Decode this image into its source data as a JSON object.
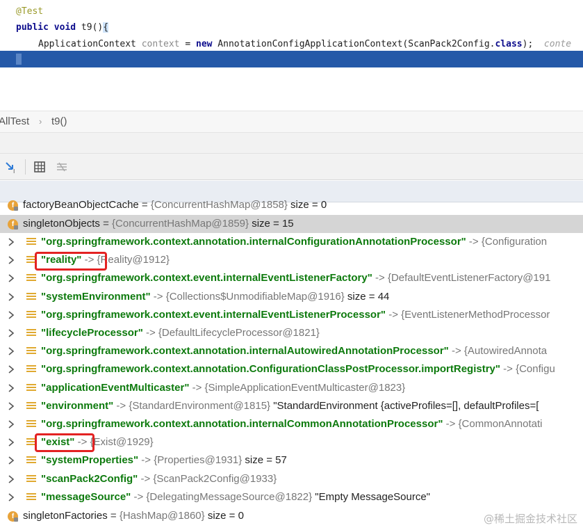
{
  "editor": {
    "annotation": "@Test",
    "sig_public": "public",
    "sig_void": "void",
    "sig_rest": " t9()",
    "sig_brace": "{",
    "stmt_type": "ApplicationContext ",
    "stmt_var": "context",
    "stmt_eq": " = ",
    "stmt_new": "new",
    "stmt_ctor": " AnnotationConfigApplicationContext(ScanPack2Config.",
    "stmt_class": "class",
    "stmt_end": ");",
    "stmt_hint": "  conte"
  },
  "breadcrumb": {
    "class_name": "AllTest",
    "separator": "›",
    "method_name": "t9()"
  },
  "toolbar": {
    "icons": [
      "step-into-icon",
      "table-view-icon",
      "evaluate-icon"
    ]
  },
  "tree": {
    "partial_field": {
      "name": "factoryBeanObjectCache",
      "eq": " = ",
      "value": "{ConcurrentHashMap@1858}",
      "size": "  size = 0"
    },
    "selected_field": {
      "name": "singletonObjects",
      "eq": " = ",
      "value": "{ConcurrentHashMap@1859}",
      "size": "  size = 15"
    },
    "entries": [
      {
        "key": "\"org.springframework.context.annotation.internalConfigurationAnnotationProcessor\"",
        "arrow": " -> ",
        "value": "{Configuration",
        "extra": ""
      },
      {
        "key": "\"reality\"",
        "arrow": " -> ",
        "value": "{Reality@1912}",
        "extra": ""
      },
      {
        "key": "\"org.springframework.context.event.internalEventListenerFactory\"",
        "arrow": " -> ",
        "value": "{DefaultEventListenerFactory@191",
        "extra": ""
      },
      {
        "key": "\"systemEnvironment\"",
        "arrow": " -> ",
        "value": "{Collections$UnmodifiableMap@1916}",
        "extra": "  size = 44"
      },
      {
        "key": "\"org.springframework.context.event.internalEventListenerProcessor\"",
        "arrow": " -> ",
        "value": "{EventListenerMethodProcessor",
        "extra": ""
      },
      {
        "key": "\"lifecycleProcessor\"",
        "arrow": " -> ",
        "value": "{DefaultLifecycleProcessor@1821}",
        "extra": ""
      },
      {
        "key": "\"org.springframework.context.annotation.internalAutowiredAnnotationProcessor\"",
        "arrow": " -> ",
        "value": "{AutowiredAnnota",
        "extra": ""
      },
      {
        "key": "\"org.springframework.context.annotation.ConfigurationClassPostProcessor.importRegistry\"",
        "arrow": " -> ",
        "value": "{Configu",
        "extra": ""
      },
      {
        "key": "\"applicationEventMulticaster\"",
        "arrow": " -> ",
        "value": "{SimpleApplicationEventMulticaster@1823}",
        "extra": ""
      },
      {
        "key": "\"environment\"",
        "arrow": " -> ",
        "value": "{StandardEnvironment@1815}",
        "extra": " \"StandardEnvironment {activeProfiles=[], defaultProfiles=["
      },
      {
        "key": "\"org.springframework.context.annotation.internalCommonAnnotationProcessor\"",
        "arrow": " -> ",
        "value": "{CommonAnnotati",
        "extra": ""
      },
      {
        "key": "\"exist\"",
        "arrow": " -> ",
        "value": "{Exist@1929}",
        "extra": ""
      },
      {
        "key": "\"systemProperties\"",
        "arrow": " -> ",
        "value": "{Properties@1931}",
        "extra": "  size = 57"
      },
      {
        "key": "\"scanPack2Config\"",
        "arrow": " -> ",
        "value": "{ScanPack2Config@1933}",
        "extra": ""
      },
      {
        "key": "\"messageSource\"",
        "arrow": " -> ",
        "value": "{DelegatingMessageSource@1822}",
        "extra": " \"Empty MessageSource\""
      }
    ],
    "next_field": {
      "name": "singletonFactories",
      "eq": " = ",
      "value": "{HashMap@1860}",
      "size": "  size = 0"
    }
  },
  "highlights": [
    "reality",
    "exist"
  ],
  "watermark": "@稀土掘金技术社区",
  "colors": {
    "selection_bar": "#2559a8",
    "key_green": "#0d7a0d",
    "highlight_red": "#e32222",
    "field_icon": "#e8a33a"
  }
}
